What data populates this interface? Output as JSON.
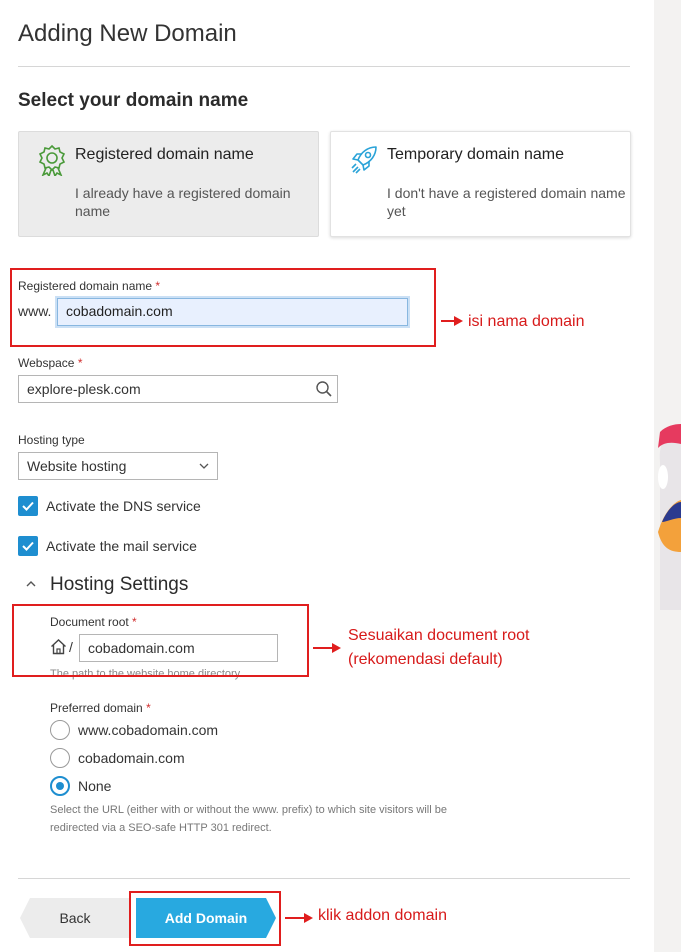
{
  "page": {
    "title": "Adding New Domain",
    "section_title": "Select your domain name"
  },
  "cards": [
    {
      "title": "Registered domain name",
      "desc": "I already have a registered domain name",
      "selected": true,
      "icon": "badge-icon"
    },
    {
      "title": "Temporary domain name",
      "desc": "I don't have a registered domain name yet",
      "selected": false,
      "icon": "rocket-icon"
    }
  ],
  "form": {
    "domain_label": "Registered domain name",
    "required_mark": "*",
    "www_prefix": "www.",
    "domain_value": "cobadomain.com",
    "webspace_label": "Webspace",
    "webspace_value": "explore-plesk.com",
    "hosting_type_label": "Hosting type",
    "hosting_type_value": "Website hosting",
    "dns_label": "Activate the DNS service",
    "dns_checked": true,
    "mail_label": "Activate the mail service",
    "mail_checked": true
  },
  "hosting_settings": {
    "title": "Hosting Settings",
    "docroot_label": "Document root",
    "docroot_slash": "/",
    "docroot_value": "cobadomain.com",
    "docroot_hint": "The path to the website home directory.",
    "preferred_label": "Preferred domain",
    "options": [
      {
        "label": "www.cobadomain.com",
        "checked": false
      },
      {
        "label": "cobadomain.com",
        "checked": false
      },
      {
        "label": "None",
        "checked": true
      }
    ],
    "preferred_desc": "Select the URL (either with or without the www. prefix) to which site visitors will be redirected via a SEO-safe HTTP 301 redirect."
  },
  "buttons": {
    "back": "Back",
    "add": "Add Domain"
  },
  "annotations": {
    "domain_note": "isi nama domain",
    "docroot_note_1": "Sesuaikan document root",
    "docroot_note_2": "(rekomendasi default)",
    "add_note": "klik addon domain"
  },
  "colors": {
    "accent": "#1e8ed0",
    "primary_button": "#28a9e0",
    "annotation_red": "#e01e1e",
    "required": "#d02d2d"
  }
}
